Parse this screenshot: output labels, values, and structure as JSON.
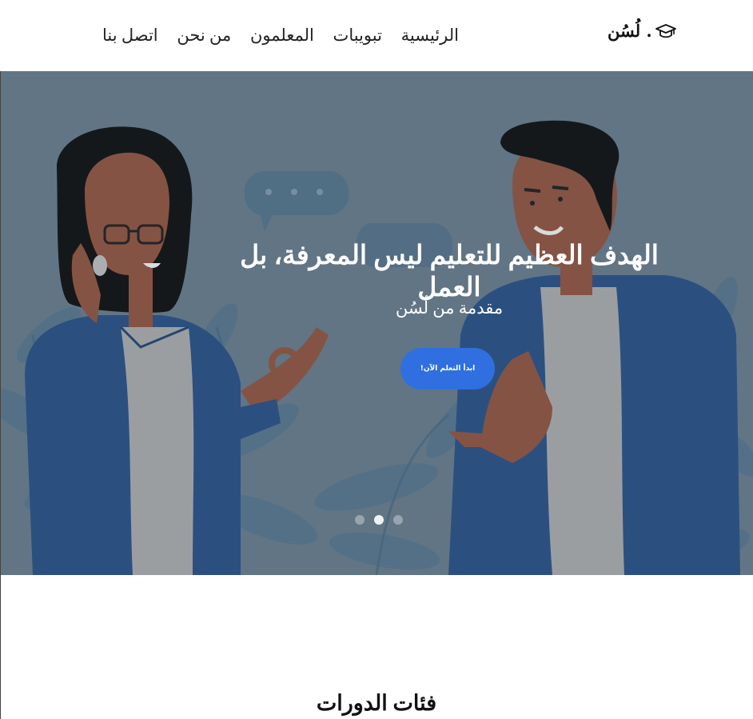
{
  "brand": {
    "name": "لُسُن .",
    "icon": "graduation-cap-icon"
  },
  "nav": {
    "items": [
      {
        "label": "الرئيسية"
      },
      {
        "label": "تبويبات"
      },
      {
        "label": "المعلمون"
      },
      {
        "label": "من نحن"
      },
      {
        "label": "اتصل بنا"
      }
    ]
  },
  "hero": {
    "heading": "الهدف العظيم للتعليم ليس المعرفة، بل العمل",
    "subheading": "مقدمة من لُسُن",
    "cta_label": "ابدأ التعلم الآن!",
    "slides": {
      "count": 3,
      "active_index": 1
    }
  },
  "courses_section": {
    "title": "فئات الدورات"
  },
  "colors": {
    "accent": "#2f6fe0",
    "hero_background": "#6e8393",
    "jacket": "#2c568d",
    "skin": "#9a5a43"
  }
}
